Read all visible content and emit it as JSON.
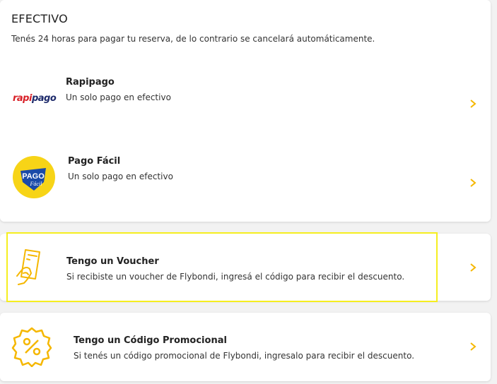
{
  "section": {
    "title": "EFECTIVO",
    "subtitle": "Tenés 24 horas para pagar tu reserva, de lo contrario se cancelará automáticamente."
  },
  "payment_methods": [
    {
      "logo_text_a": "rapi",
      "logo_text_b": "pago",
      "title": "Rapipago",
      "description": "Un solo pago en efectivo",
      "icon": "rapipago-logo"
    },
    {
      "logo_text_a": "PAGO",
      "logo_text_b": "Fácil",
      "title": "Pago Fácil",
      "description": "Un solo pago en efectivo",
      "icon": "pagofacil-logo"
    }
  ],
  "voucher": {
    "title": "Tengo un Voucher",
    "description": "Si recibiste un voucher de Flybondi, ingresá el código para recibir el descuento.",
    "icon": "voucher-hand-icon"
  },
  "promo": {
    "title": "Tengo un Código Promocional",
    "description": "Si tenés un código promocional de Flybondi, ingresalo para recibir el descuento.",
    "icon": "percent-badge-icon"
  },
  "colors": {
    "accent": "#f5b700",
    "highlight": "#f5ee1f",
    "rapipago_red": "#d81f26",
    "rapipago_blue": "#1d2a6b",
    "pagofacil_yellow": "#f7d417",
    "pagofacil_blue": "#1a4aa8"
  },
  "chevron_icon": "chevron-right-icon"
}
